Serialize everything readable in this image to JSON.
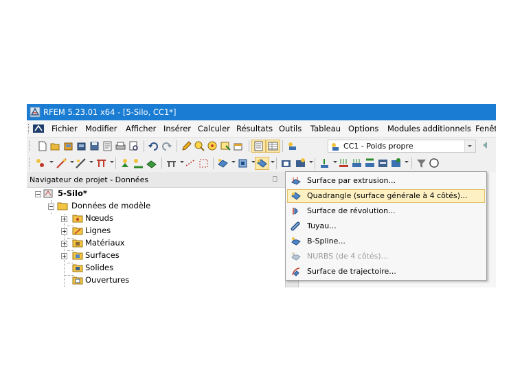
{
  "window": {
    "title": "RFEM 5.23.01 x64 - [5-Silo, CC1*]"
  },
  "menu": [
    {
      "label": "Fichier"
    },
    {
      "label": "Modifier"
    },
    {
      "label": "Afficher"
    },
    {
      "label": "Insérer"
    },
    {
      "label": "Calculer"
    },
    {
      "label": "Résultats"
    },
    {
      "label": "Outils"
    },
    {
      "label": "Tableau"
    },
    {
      "label": "Options"
    },
    {
      "label": "Modules additionnels"
    },
    {
      "label": "Fenêt"
    }
  ],
  "loadcase": {
    "selected": "CC1 - Poids propre"
  },
  "navigator": {
    "title": "Navigateur de projet - Données",
    "pin": "⎕",
    "tree": [
      {
        "label": "5-Silo*"
      },
      {
        "label": "Données de modèle"
      },
      {
        "label": "Nœuds"
      },
      {
        "label": "Lignes"
      },
      {
        "label": "Matériaux"
      },
      {
        "label": "Surfaces"
      },
      {
        "label": "Solides"
      },
      {
        "label": "Ouvertures"
      }
    ]
  },
  "dropdown": {
    "items": [
      {
        "label": "Surface par extrusion...",
        "icon": "extrusion-surface-icon",
        "enabled": true
      },
      {
        "label": "Quadrangle (surface générale à 4 côtés)...",
        "icon": "quadrangle-surface-icon",
        "enabled": true,
        "highlighted": true
      },
      {
        "label": "Surface de révolution...",
        "icon": "revolution-surface-icon",
        "enabled": true
      },
      {
        "label": "Tuyau...",
        "icon": "pipe-surface-icon",
        "enabled": true
      },
      {
        "label": "B-Spline...",
        "icon": "bspline-surface-icon",
        "enabled": true
      },
      {
        "label": "NURBS (de 4 côtés)...",
        "icon": "nurbs-surface-icon",
        "enabled": false
      },
      {
        "label": "Surface de trajectoire...",
        "icon": "trajectory-surface-icon",
        "enabled": true
      }
    ]
  },
  "colors": {
    "titlebar": "#1a7dd3",
    "highlight": "#fdf1c3",
    "disabled_text": "#9b9b9b"
  }
}
